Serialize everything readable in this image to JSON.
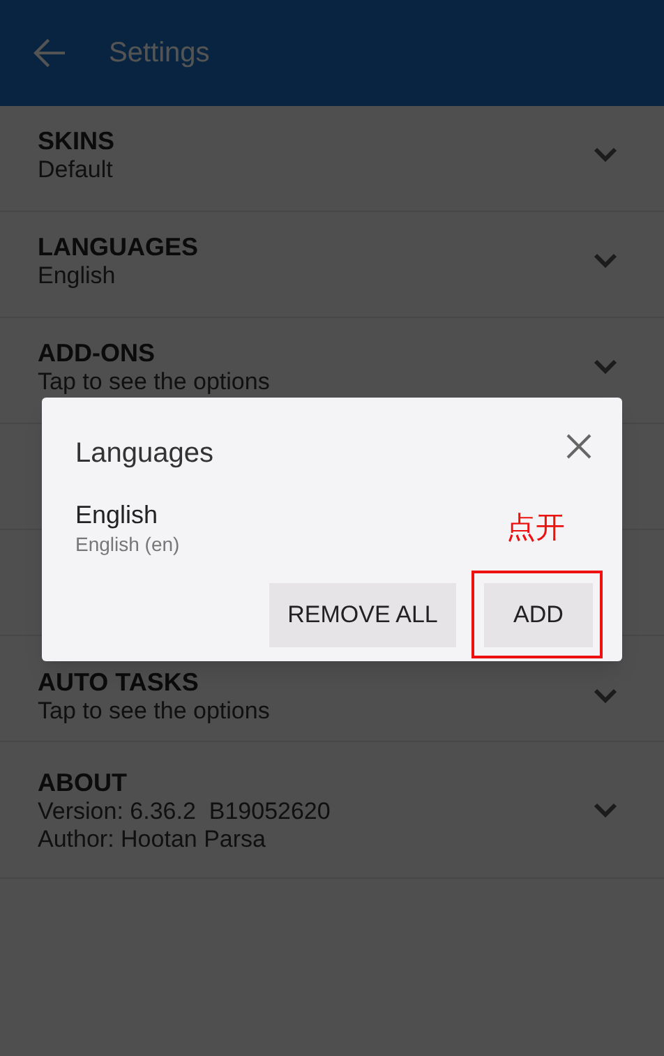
{
  "app_bar": {
    "title": "Settings"
  },
  "settings": [
    {
      "title": "SKINS",
      "lines": [
        "Default"
      ]
    },
    {
      "title": "LANGUAGES",
      "lines": [
        "English"
      ]
    },
    {
      "title": "ADD-ONS",
      "lines": [
        "Tap to see the options"
      ]
    },
    {
      "kind": "covered"
    },
    {
      "kind": "covered"
    },
    {
      "title": "AUTO TASKS",
      "lines": [
        "Tap to see the options"
      ]
    },
    {
      "title": "ABOUT",
      "lines": [
        "Version: 6.36.2  B19052620",
        "Author: Hootan Parsa"
      ]
    }
  ],
  "dialog": {
    "title": "Languages",
    "languages": [
      {
        "name": "English",
        "detail": "English (en)"
      }
    ],
    "buttons": [
      {
        "label": "REMOVE ALL",
        "highlighted": false
      },
      {
        "label": "ADD",
        "highlighted": true
      }
    ],
    "annotation": "点开"
  }
}
